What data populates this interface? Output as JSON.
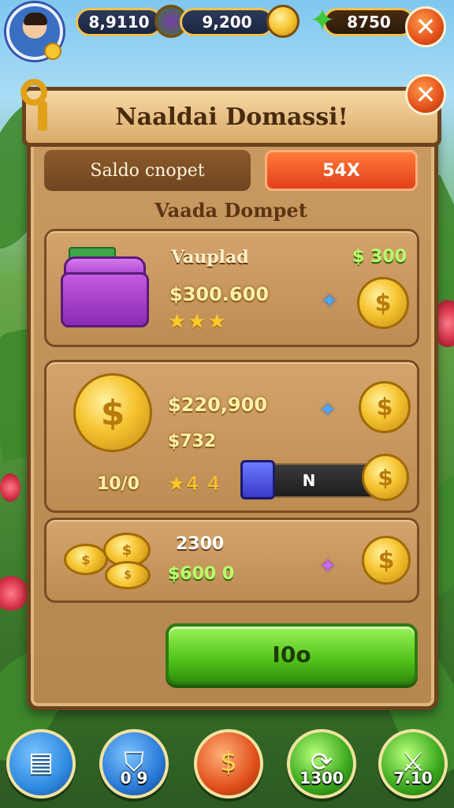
{
  "header": {
    "resources": [
      {
        "value": "8,9110",
        "icon": "gem-coin-icon"
      },
      {
        "value": "9,200",
        "icon": "gold-coin-icon"
      },
      {
        "value": "8750",
        "icon": "green-star-icon"
      }
    ]
  },
  "dialog": {
    "title": "Naaldai Domassi!",
    "tab_left": "Saldo cnopet",
    "tab_right": "54X",
    "subtitle": "Vaada Dompet",
    "offers": [
      {
        "name": "Vauplad",
        "price": "$ 300",
        "amount": "$300.600",
        "stars": "★★★"
      },
      {
        "amount": "$220,900",
        "sub": "$732",
        "left_label": "10/0",
        "rating": "★4 4",
        "buy_label": "N"
      },
      {
        "amount_top": "2300",
        "amount": "$600 0"
      }
    ],
    "confirm_label": "I0o"
  },
  "nav": [
    {
      "label": "",
      "icon": "scroll-icon",
      "color": "#2e8ae0"
    },
    {
      "label": "0 9",
      "icon": "shield-icon",
      "color": "#2a7ad8"
    },
    {
      "label": "",
      "icon": "dollar-icon",
      "color": "#e2501a"
    },
    {
      "label": "1300",
      "icon": "refresh-icon",
      "color": "#3aa81e"
    },
    {
      "label": "7.10",
      "icon": "swords-icon",
      "color": "#3aa81e"
    }
  ]
}
